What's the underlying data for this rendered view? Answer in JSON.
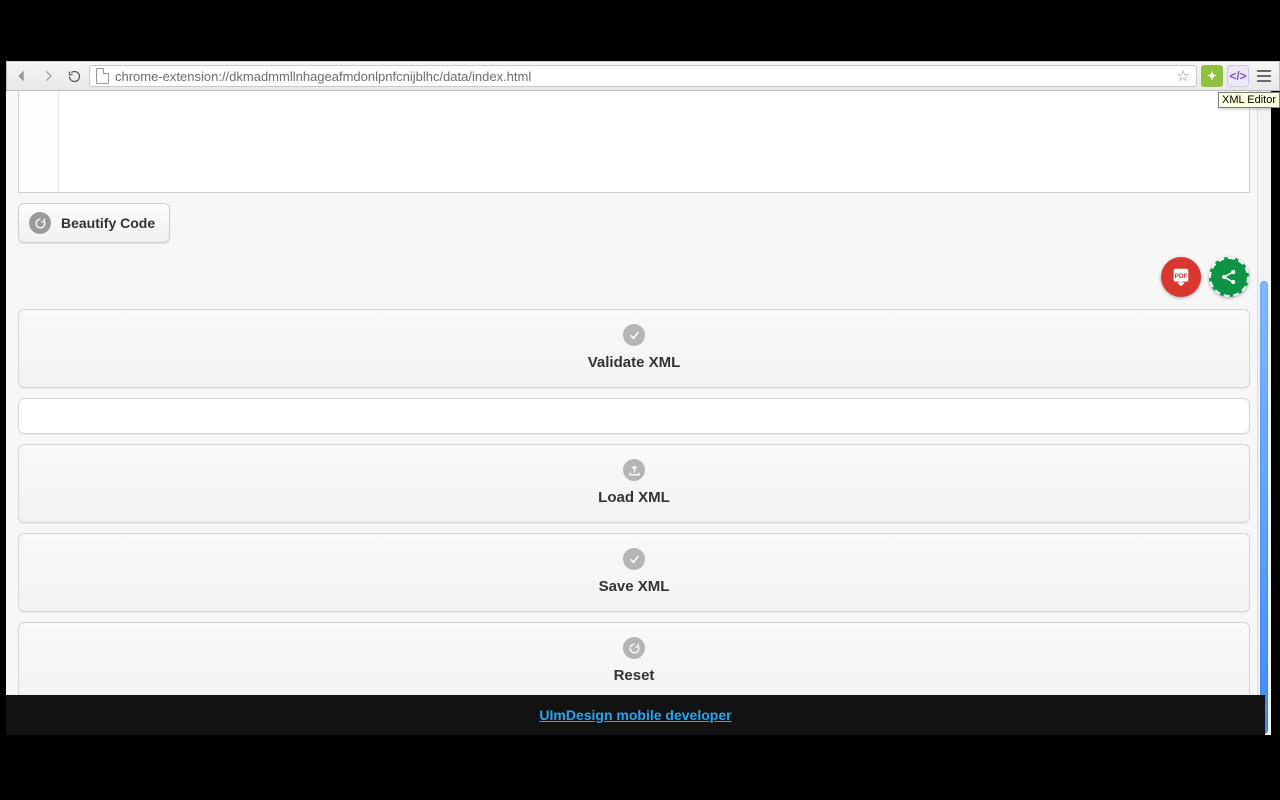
{
  "browser": {
    "url": "chrome-extension://dkmadmmllnhageafmdonlpnfcnijblhc/data/index.html",
    "tooltip": "XML Editor"
  },
  "editor": {
    "beautify_label": "Beautify Code"
  },
  "fab": {
    "pdf_label": "PDF",
    "share_label": "Share"
  },
  "actions": {
    "validate": "Validate XML",
    "load": "Load XML",
    "save": "Save XML",
    "reset": "Reset"
  },
  "footer": {
    "link_text": "UImDesign mobile developer"
  }
}
